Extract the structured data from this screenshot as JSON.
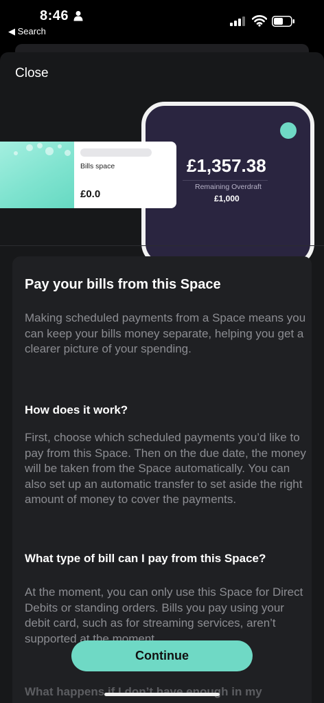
{
  "status_bar": {
    "time": "8:46",
    "back_label": "◀ Search"
  },
  "sheet": {
    "close_label": "Close"
  },
  "hero": {
    "space_card": {
      "name": "Bills space",
      "amount": "£0.0"
    },
    "phone": {
      "balance": "£1,357.38",
      "overdraft_label": "Remaining Overdraft",
      "overdraft_amount": "£1,000"
    }
  },
  "content": {
    "title": "Pay your bills from this Space",
    "intro": "Making scheduled payments from a Space means you can keep your bills money separate, helping you get a clearer picture of your spending.",
    "sections": [
      {
        "heading": "How does it work?",
        "body": "First, choose which scheduled payments you’d like to pay from this Space. Then on the due date, the money will be taken from the Space automatically. You can also set up an automatic transfer to set aside the right amount of money to cover the payments."
      },
      {
        "heading": "What type of bill can I pay from this Space?",
        "body": "At the moment, you can only use this Space for Direct Debits or standing orders. Bills you pay using your debit card, such as for streaming services, aren’t supported at the moment."
      },
      {
        "heading": "What happens if I don’t have enough in my"
      }
    ]
  },
  "footer": {
    "continue_label": "Continue"
  },
  "colors": {
    "accent": "#6fd9c5",
    "sheet_bg": "#17181a",
    "card_bg": "#1f2023",
    "phone_bg": "#2a2540"
  }
}
